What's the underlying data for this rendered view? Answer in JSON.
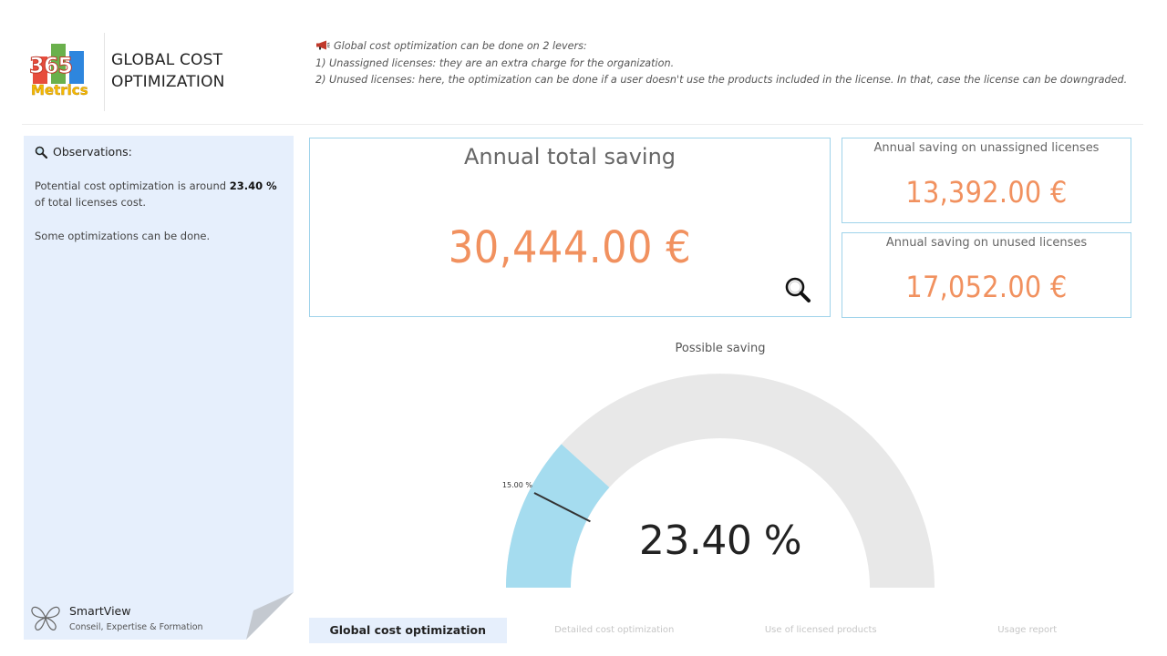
{
  "app": {
    "logo_digits": "365",
    "logo_word": "Metrics",
    "page_title": "GLOBAL COST OPTIMIZATION"
  },
  "notes": {
    "line1": "Global cost optimization can be done on 2 levers:",
    "line2": "1) Unassigned licenses: they are an extra charge for the organization.",
    "line3": "2) Unused licenses: here, the optimization can be done if a user doesn't use the products included in the license. In that, case the license can be downgraded."
  },
  "observations": {
    "title": "Observations:",
    "text_prefix": "Potential cost optimization is around",
    "percent": "23.40 %",
    "text_suffix": "of total licenses cost.",
    "note": "Some optimizations can be done."
  },
  "brand": {
    "name": "SmartView",
    "tagline": "Conseil, Expertise & Formation"
  },
  "cards": {
    "total": {
      "title": "Annual total saving",
      "value": "30,444.00 €"
    },
    "unassigned": {
      "title": "Annual saving on unassigned licenses",
      "value": "13,392.00 €"
    },
    "unused": {
      "title": "Annual saving on unused licenses",
      "value": "17,052.00 €"
    }
  },
  "gauge": {
    "title": "Possible saving",
    "value_label": "23.40 %",
    "value": 23.4,
    "max": 100,
    "target": 15.0,
    "target_label": "15.00 %"
  },
  "tabs": [
    {
      "label": "Global cost optimization",
      "active": true
    },
    {
      "label": "Detailed cost optimization",
      "active": false
    },
    {
      "label": "Use of licensed products",
      "active": false
    },
    {
      "label": "Usage report",
      "active": false
    }
  ],
  "colors": {
    "value_orange": "#f1915f",
    "gauge_fill": "#a5dcef",
    "gauge_track": "#e8e8e8",
    "card_border": "#9fd3ea",
    "sidebar_bg": "#e6effc"
  }
}
